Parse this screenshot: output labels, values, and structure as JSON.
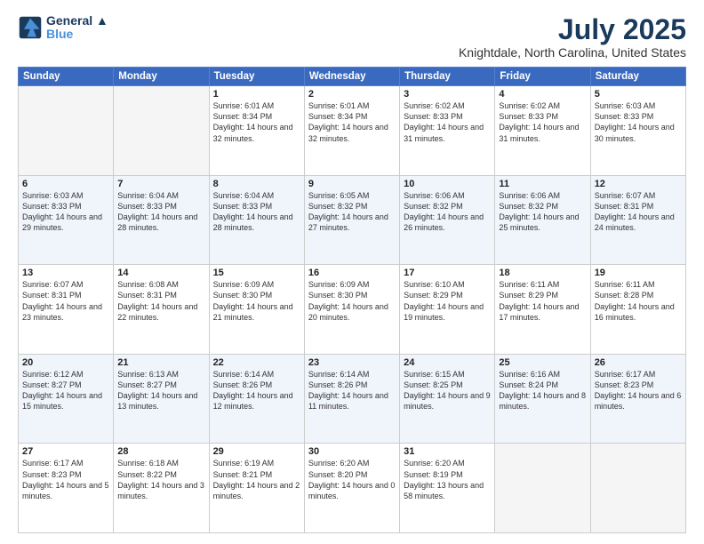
{
  "logo": {
    "line1": "General",
    "line2": "Blue"
  },
  "title": "July 2025",
  "subtitle": "Knightdale, North Carolina, United States",
  "weekdays": [
    "Sunday",
    "Monday",
    "Tuesday",
    "Wednesday",
    "Thursday",
    "Friday",
    "Saturday"
  ],
  "weeks": [
    [
      {
        "day": "",
        "info": ""
      },
      {
        "day": "",
        "info": ""
      },
      {
        "day": "1",
        "info": "Sunrise: 6:01 AM\nSunset: 8:34 PM\nDaylight: 14 hours and 32 minutes."
      },
      {
        "day": "2",
        "info": "Sunrise: 6:01 AM\nSunset: 8:34 PM\nDaylight: 14 hours and 32 minutes."
      },
      {
        "day": "3",
        "info": "Sunrise: 6:02 AM\nSunset: 8:33 PM\nDaylight: 14 hours and 31 minutes."
      },
      {
        "day": "4",
        "info": "Sunrise: 6:02 AM\nSunset: 8:33 PM\nDaylight: 14 hours and 31 minutes."
      },
      {
        "day": "5",
        "info": "Sunrise: 6:03 AM\nSunset: 8:33 PM\nDaylight: 14 hours and 30 minutes."
      }
    ],
    [
      {
        "day": "6",
        "info": "Sunrise: 6:03 AM\nSunset: 8:33 PM\nDaylight: 14 hours and 29 minutes."
      },
      {
        "day": "7",
        "info": "Sunrise: 6:04 AM\nSunset: 8:33 PM\nDaylight: 14 hours and 28 minutes."
      },
      {
        "day": "8",
        "info": "Sunrise: 6:04 AM\nSunset: 8:33 PM\nDaylight: 14 hours and 28 minutes."
      },
      {
        "day": "9",
        "info": "Sunrise: 6:05 AM\nSunset: 8:32 PM\nDaylight: 14 hours and 27 minutes."
      },
      {
        "day": "10",
        "info": "Sunrise: 6:06 AM\nSunset: 8:32 PM\nDaylight: 14 hours and 26 minutes."
      },
      {
        "day": "11",
        "info": "Sunrise: 6:06 AM\nSunset: 8:32 PM\nDaylight: 14 hours and 25 minutes."
      },
      {
        "day": "12",
        "info": "Sunrise: 6:07 AM\nSunset: 8:31 PM\nDaylight: 14 hours and 24 minutes."
      }
    ],
    [
      {
        "day": "13",
        "info": "Sunrise: 6:07 AM\nSunset: 8:31 PM\nDaylight: 14 hours and 23 minutes."
      },
      {
        "day": "14",
        "info": "Sunrise: 6:08 AM\nSunset: 8:31 PM\nDaylight: 14 hours and 22 minutes."
      },
      {
        "day": "15",
        "info": "Sunrise: 6:09 AM\nSunset: 8:30 PM\nDaylight: 14 hours and 21 minutes."
      },
      {
        "day": "16",
        "info": "Sunrise: 6:09 AM\nSunset: 8:30 PM\nDaylight: 14 hours and 20 minutes."
      },
      {
        "day": "17",
        "info": "Sunrise: 6:10 AM\nSunset: 8:29 PM\nDaylight: 14 hours and 19 minutes."
      },
      {
        "day": "18",
        "info": "Sunrise: 6:11 AM\nSunset: 8:29 PM\nDaylight: 14 hours and 17 minutes."
      },
      {
        "day": "19",
        "info": "Sunrise: 6:11 AM\nSunset: 8:28 PM\nDaylight: 14 hours and 16 minutes."
      }
    ],
    [
      {
        "day": "20",
        "info": "Sunrise: 6:12 AM\nSunset: 8:27 PM\nDaylight: 14 hours and 15 minutes."
      },
      {
        "day": "21",
        "info": "Sunrise: 6:13 AM\nSunset: 8:27 PM\nDaylight: 14 hours and 13 minutes."
      },
      {
        "day": "22",
        "info": "Sunrise: 6:14 AM\nSunset: 8:26 PM\nDaylight: 14 hours and 12 minutes."
      },
      {
        "day": "23",
        "info": "Sunrise: 6:14 AM\nSunset: 8:26 PM\nDaylight: 14 hours and 11 minutes."
      },
      {
        "day": "24",
        "info": "Sunrise: 6:15 AM\nSunset: 8:25 PM\nDaylight: 14 hours and 9 minutes."
      },
      {
        "day": "25",
        "info": "Sunrise: 6:16 AM\nSunset: 8:24 PM\nDaylight: 14 hours and 8 minutes."
      },
      {
        "day": "26",
        "info": "Sunrise: 6:17 AM\nSunset: 8:23 PM\nDaylight: 14 hours and 6 minutes."
      }
    ],
    [
      {
        "day": "27",
        "info": "Sunrise: 6:17 AM\nSunset: 8:23 PM\nDaylight: 14 hours and 5 minutes."
      },
      {
        "day": "28",
        "info": "Sunrise: 6:18 AM\nSunset: 8:22 PM\nDaylight: 14 hours and 3 minutes."
      },
      {
        "day": "29",
        "info": "Sunrise: 6:19 AM\nSunset: 8:21 PM\nDaylight: 14 hours and 2 minutes."
      },
      {
        "day": "30",
        "info": "Sunrise: 6:20 AM\nSunset: 8:20 PM\nDaylight: 14 hours and 0 minutes."
      },
      {
        "day": "31",
        "info": "Sunrise: 6:20 AM\nSunset: 8:19 PM\nDaylight: 13 hours and 58 minutes."
      },
      {
        "day": "",
        "info": ""
      },
      {
        "day": "",
        "info": ""
      }
    ]
  ]
}
